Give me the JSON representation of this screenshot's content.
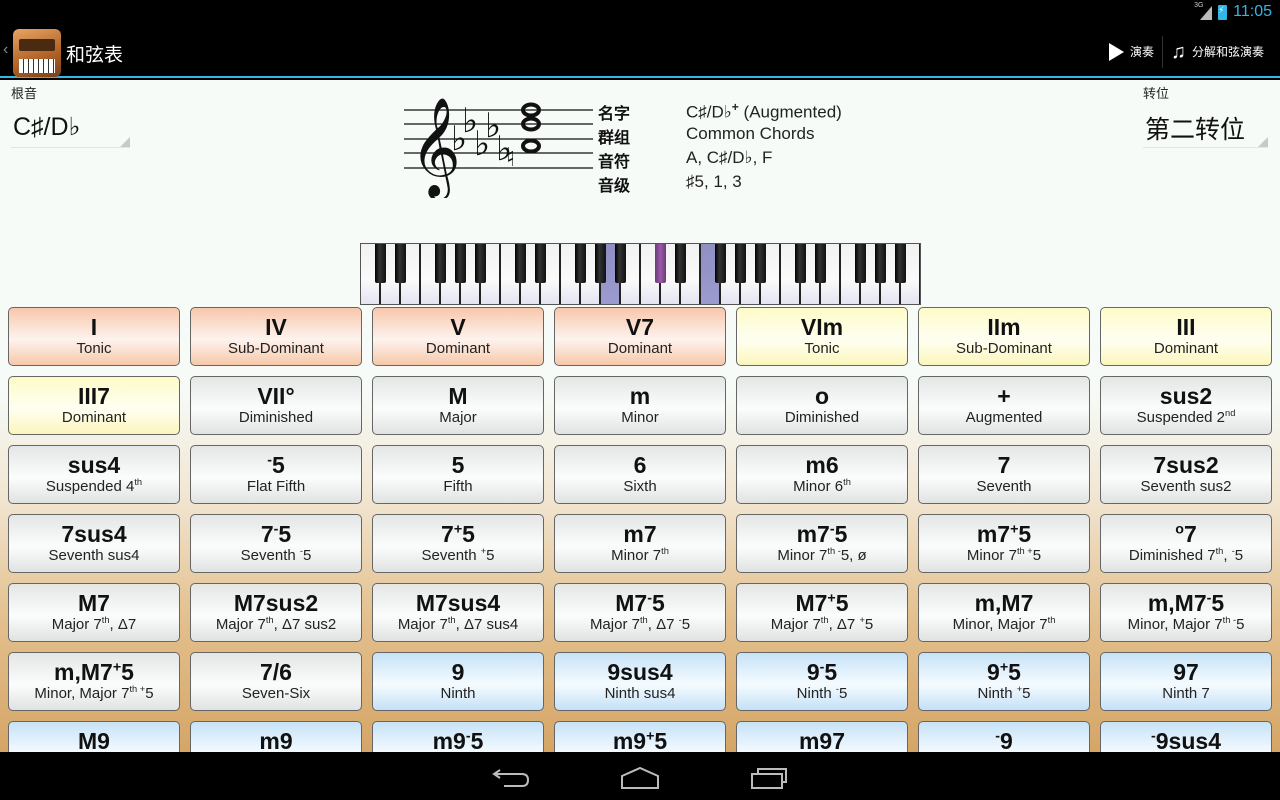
{
  "status_bar": {
    "network": "3G",
    "time": "11:05"
  },
  "action_bar": {
    "title": "和弦表",
    "play_label": "演奏",
    "arpeggio_label": "分解和弦演奏"
  },
  "root": {
    "label": "根音",
    "value": "C♯/D♭"
  },
  "inversion": {
    "label": "转位",
    "value": "第二转位"
  },
  "chord_info": {
    "name_key": "名字",
    "name_value_base": "C♯/D♭",
    "name_value_sup": "+",
    "name_value_suffix": " (Augmented)",
    "group_key": "群组",
    "group_value": "Common Chords",
    "notes_key": "音符",
    "notes_value": "A, C♯/D♭, F",
    "degrees_key": "音级",
    "degrees_value": "♯5, 1, 3"
  },
  "keyboard": {
    "start_note": "C",
    "octaves": 4,
    "highlighted_keys": [
      {
        "octave": 1,
        "note": "A"
      },
      {
        "octave": 2,
        "note": "C#"
      },
      {
        "octave": 2,
        "note": "F"
      }
    ],
    "colors": {
      "white_highlight": "#9b9bd0",
      "black_highlight": "#9a5aa8"
    }
  },
  "chords": [
    {
      "sym": "I",
      "desc": "Tonic",
      "color": "orange"
    },
    {
      "sym": "IV",
      "desc": "Sub-Dominant",
      "color": "orange"
    },
    {
      "sym": "V",
      "desc": "Dominant",
      "color": "orange"
    },
    {
      "sym": "V7",
      "desc": "Dominant",
      "color": "orange"
    },
    {
      "sym": "VIm",
      "desc": "Tonic",
      "color": "yellow"
    },
    {
      "sym": "IIm",
      "desc": "Sub-Dominant",
      "color": "yellow"
    },
    {
      "sym": "III",
      "desc": "Dominant",
      "color": "yellow"
    },
    {
      "sym": "III7",
      "desc": "Dominant",
      "color": "yellow"
    },
    {
      "sym": "VII°",
      "desc": "Diminished",
      "color": "gray"
    },
    {
      "sym": "M",
      "desc": "Major",
      "color": "gray"
    },
    {
      "sym": "m",
      "desc": "Minor",
      "color": "gray"
    },
    {
      "sym": "o",
      "desc": "Diminished",
      "color": "gray"
    },
    {
      "sym": "+",
      "desc": "Augmented",
      "color": "gray"
    },
    {
      "sym": "sus2",
      "desc": "Suspended 2",
      "desc_sup": "nd",
      "color": "gray"
    },
    {
      "sym": "sus4",
      "desc": "Suspended 4",
      "desc_sup": "th",
      "color": "gray"
    },
    {
      "sym_sup_pre": "-",
      "sym": "5",
      "desc": "Flat Fifth",
      "color": "gray"
    },
    {
      "sym": "5",
      "desc": "Fifth",
      "color": "gray"
    },
    {
      "sym": "6",
      "desc": "Sixth",
      "color": "gray"
    },
    {
      "sym": "m6",
      "desc": "Minor 6",
      "desc_sup": "th",
      "color": "gray"
    },
    {
      "sym": "7",
      "desc": "Seventh",
      "color": "gray"
    },
    {
      "sym": "7sus2",
      "desc": "Seventh sus2",
      "color": "gray"
    },
    {
      "sym": "7sus4",
      "desc": "Seventh sus4",
      "color": "gray"
    },
    {
      "sym": "7",
      "sym_sup": "-",
      "sym_post": "5",
      "desc": "Seventh ",
      "desc_sup": "-",
      "desc_post": "5",
      "color": "gray"
    },
    {
      "sym": "7",
      "sym_sup": "+",
      "sym_post": "5",
      "desc": "Seventh ",
      "desc_sup": "+",
      "desc_post": "5",
      "color": "gray"
    },
    {
      "sym": "m7",
      "desc": "Minor 7",
      "desc_sup": "th",
      "color": "gray"
    },
    {
      "sym": "m7",
      "sym_sup": "-",
      "sym_post": "5",
      "desc": "Minor 7",
      "desc_sup": "th -",
      "desc_post": "5, ø",
      "color": "gray"
    },
    {
      "sym": "m7",
      "sym_sup": "+",
      "sym_post": "5",
      "desc": "Minor 7",
      "desc_sup": "th +",
      "desc_post": "5",
      "color": "gray"
    },
    {
      "sym_sup_pre": "o",
      "sym": "7",
      "desc": "Diminished 7",
      "desc_sup": "th",
      "desc_post": ", ",
      "desc_sup2": "-",
      "desc_post2": "5",
      "color": "gray"
    },
    {
      "sym": "M7",
      "desc": "Major 7",
      "desc_sup": "th",
      "desc_post": ", Δ7",
      "color": "gray"
    },
    {
      "sym": "M7sus2",
      "desc": "Major 7",
      "desc_sup": "th",
      "desc_post": ", Δ7 sus2",
      "color": "gray"
    },
    {
      "sym": "M7sus4",
      "desc": "Major 7",
      "desc_sup": "th",
      "desc_post": ", Δ7 sus4",
      "color": "gray"
    },
    {
      "sym": "M7",
      "sym_sup": "-",
      "sym_post": "5",
      "desc": "Major 7",
      "desc_sup": "th",
      "desc_post": ", Δ7 ",
      "desc_sup2": "-",
      "desc_post2": "5",
      "color": "gray"
    },
    {
      "sym": "M7",
      "sym_sup": "+",
      "sym_post": "5",
      "desc": "Major 7",
      "desc_sup": "th",
      "desc_post": ", Δ7 ",
      "desc_sup2": "+",
      "desc_post2": "5",
      "color": "gray"
    },
    {
      "sym": "m,M7",
      "desc": "Minor, Major 7",
      "desc_sup": "th",
      "color": "gray"
    },
    {
      "sym": "m,M7",
      "sym_sup": "-",
      "sym_post": "5",
      "desc": "Minor, Major 7",
      "desc_sup": "th -",
      "desc_post": "5",
      "color": "gray"
    },
    {
      "sym": "m,M7",
      "sym_sup": "+",
      "sym_post": "5",
      "desc": "Minor, Major 7",
      "desc_sup": "th +",
      "desc_post": "5",
      "color": "gray"
    },
    {
      "sym": "7/6",
      "desc": "Seven-Six",
      "color": "gray"
    },
    {
      "sym": "9",
      "desc": "Ninth",
      "color": "blue"
    },
    {
      "sym": "9sus4",
      "desc": "Ninth sus4",
      "color": "blue"
    },
    {
      "sym": "9",
      "sym_sup": "-",
      "sym_post": "5",
      "desc": "Ninth ",
      "desc_sup": "-",
      "desc_post": "5",
      "color": "blue"
    },
    {
      "sym": "9",
      "sym_sup": "+",
      "sym_post": "5",
      "desc": "Ninth ",
      "desc_sup": "+",
      "desc_post": "5",
      "color": "blue"
    },
    {
      "sym": "97",
      "desc": "Ninth 7",
      "color": "blue"
    },
    {
      "sym": "M9",
      "desc": "",
      "color": "blue"
    },
    {
      "sym": "m9",
      "desc": "",
      "color": "blue"
    },
    {
      "sym": "m9",
      "sym_sup": "-",
      "sym_post": "5",
      "desc": "",
      "color": "blue"
    },
    {
      "sym": "m9",
      "sym_sup": "+",
      "sym_post": "5",
      "desc": "",
      "color": "blue"
    },
    {
      "sym": "m97",
      "desc": "",
      "color": "blue"
    },
    {
      "sym_sup_pre": "-",
      "sym": "9",
      "desc": "",
      "color": "blue"
    },
    {
      "sym_sup_pre": "-",
      "sym": "9sus4",
      "desc": "",
      "color": "blue"
    }
  ]
}
